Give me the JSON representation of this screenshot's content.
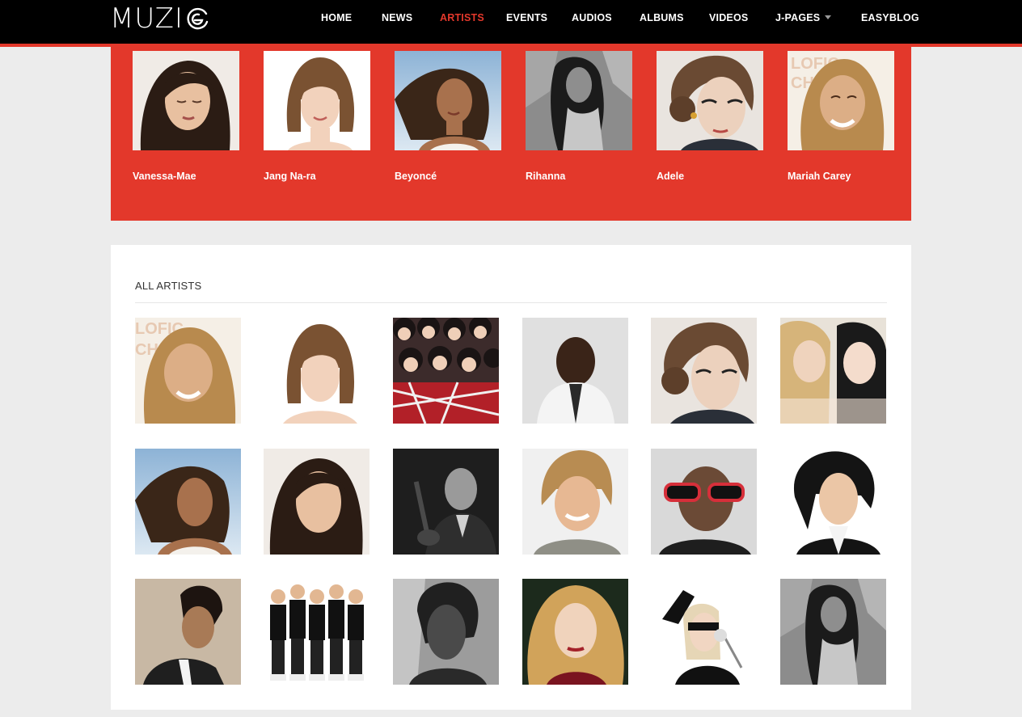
{
  "header": {
    "logo_text": "MUZI",
    "nav": [
      {
        "label": "HOME",
        "active": false
      },
      {
        "label": "NEWS",
        "active": false
      },
      {
        "label": "ARTISTS",
        "active": true
      },
      {
        "label": "EVENTS",
        "active": false
      },
      {
        "label": "AUDIOS",
        "active": false
      },
      {
        "label": "ALBUMS",
        "active": false
      },
      {
        "label": "VIDEOS",
        "active": false
      },
      {
        "label": "J-PAGES",
        "active": false,
        "has_dropdown": true
      },
      {
        "label": "EASYBLOG",
        "active": false
      }
    ]
  },
  "featured": {
    "artists": [
      {
        "name": "Vanessa-Mae"
      },
      {
        "name": "Jang Na-ra"
      },
      {
        "name": "Beyoncé"
      },
      {
        "name": "Rihanna"
      },
      {
        "name": "Adele"
      },
      {
        "name": "Mariah Carey"
      }
    ]
  },
  "all_artists": {
    "title": "ALL ARTISTS"
  },
  "colors": {
    "accent": "#e3382b",
    "header_bg": "#000000",
    "page_bg": "#ececec"
  }
}
